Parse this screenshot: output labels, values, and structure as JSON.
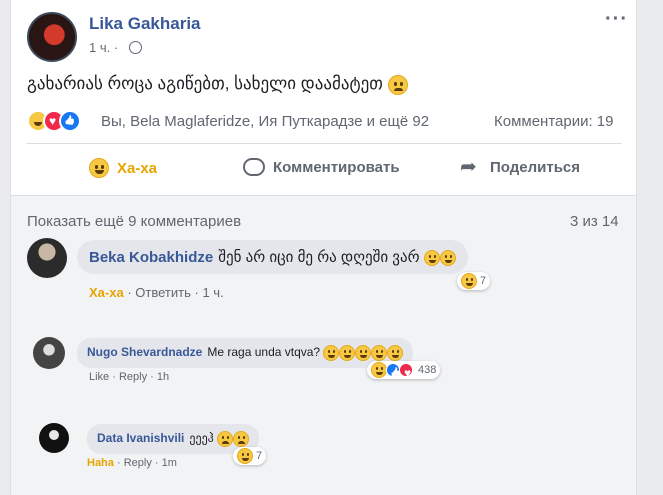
{
  "post": {
    "author": "Lika Gakharia",
    "time": "1 ч. ·",
    "text": "გახარიას როცა აგიწებთ, სახელი დაამატეთ",
    "reacted_by": "Вы, Bela Maglaferidze, Ия Путкарадзе и ещё 92",
    "comments_count": "Комментарии: 19"
  },
  "actions": {
    "haha": "Ха-ха",
    "comment": "Комментировать",
    "share": "Поделиться"
  },
  "comments_header": {
    "more": "Показать ещё 9 комментариев",
    "count": "3 из 14"
  },
  "comments": [
    {
      "name": "Beka Kobakhidze",
      "text": "შენ არ იცი მე რა დღეში ვარ",
      "reaction": "Ха-ха",
      "reply": "Ответить",
      "time": "1 ч.",
      "react_count": "7"
    },
    {
      "name": "Nugo Shevardnadze",
      "text": "Me raga unda vtqva?",
      "reaction": "Like",
      "reply": "Reply",
      "time": "1h",
      "react_count": "438"
    },
    {
      "name": "Data Ivanishvili",
      "text": "ეეეჰ",
      "reaction": "Haha",
      "reply": "Reply",
      "time": "1m",
      "react_count": "7"
    }
  ],
  "separators": {
    "dot": "·"
  },
  "colors": {
    "link": "#385898",
    "haha": "#e7a500",
    "muted": "#606770"
  }
}
